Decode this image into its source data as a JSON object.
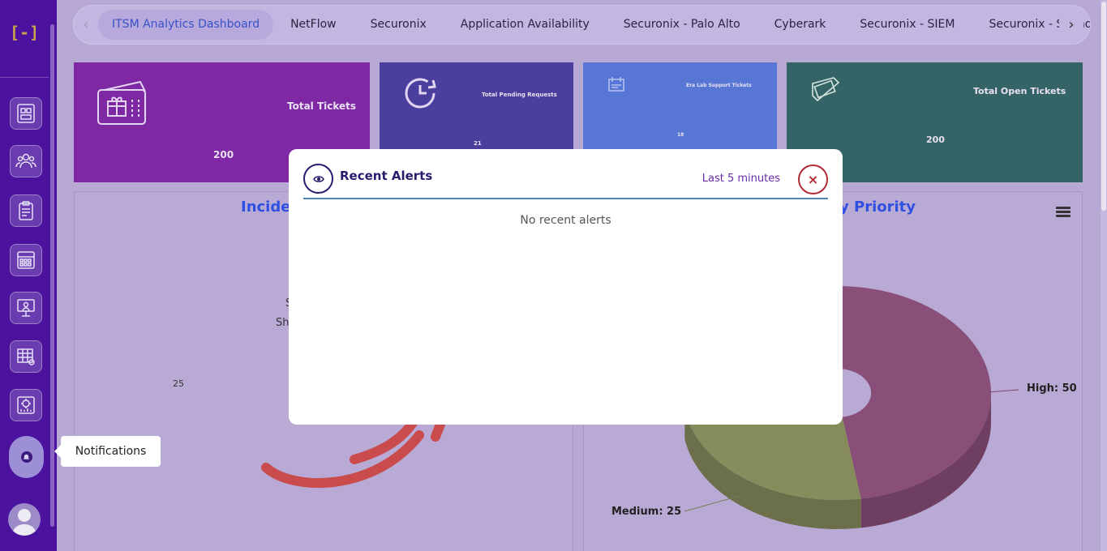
{
  "app": {
    "logo_text": "[-]"
  },
  "sidebar": {
    "items": [
      {
        "name": "tickets-nav",
        "icon": "ticket-board-icon"
      },
      {
        "name": "users-nav",
        "icon": "user-group-icon"
      },
      {
        "name": "reports-nav",
        "icon": "clipboard-icon"
      },
      {
        "name": "calendar-nav",
        "icon": "calendar-grid-icon"
      },
      {
        "name": "monitoring-nav",
        "icon": "monitor-user-icon"
      },
      {
        "name": "tables-nav",
        "icon": "table-grid-icon"
      },
      {
        "name": "settings-nav",
        "icon": "gear-chart-icon"
      }
    ],
    "notifications_icon": "bell-icon",
    "tooltip": "Notifications"
  },
  "tabs": {
    "items": [
      "ITSM Analytics Dashboard",
      "NetFlow",
      "Securonix",
      "Application Availability",
      "Securonix - Palo Alto",
      "Cyberark",
      "Securonix - SIEM",
      "Securonix - Sophos EDR"
    ],
    "active": 0,
    "prev_icon": "‹",
    "next_icon": "›"
  },
  "cards": {
    "total_tickets": {
      "title": "Total Tickets",
      "value": "200",
      "color": "#7e28a3"
    },
    "pending": {
      "title": "Total Pending Requests",
      "value": "21",
      "color": "#4a3f9c"
    },
    "era_lab": {
      "title": "Era Lab Support Tickets",
      "value": "18",
      "color": "#5876d4"
    },
    "open": {
      "title": "Total Open Tickets",
      "value": "200",
      "color": "#346465"
    }
  },
  "panels": {
    "left": {
      "title_fragment": "Incider",
      "label_a": "S",
      "label_b": "Sh",
      "axis_value": "25"
    },
    "right": {
      "title_fragment": "y Priority"
    }
  },
  "chart_data": {
    "type": "pie",
    "categories": [
      "High",
      "Medium"
    ],
    "values": [
      50,
      25
    ],
    "labels": [
      "High: 50",
      "Medium: 25"
    ],
    "colors": [
      "#8a4f78",
      "#868c5c"
    ]
  },
  "modal": {
    "title": "Recent Alerts",
    "range": "Last 5 minutes",
    "close": "×",
    "empty": "No recent alerts"
  }
}
